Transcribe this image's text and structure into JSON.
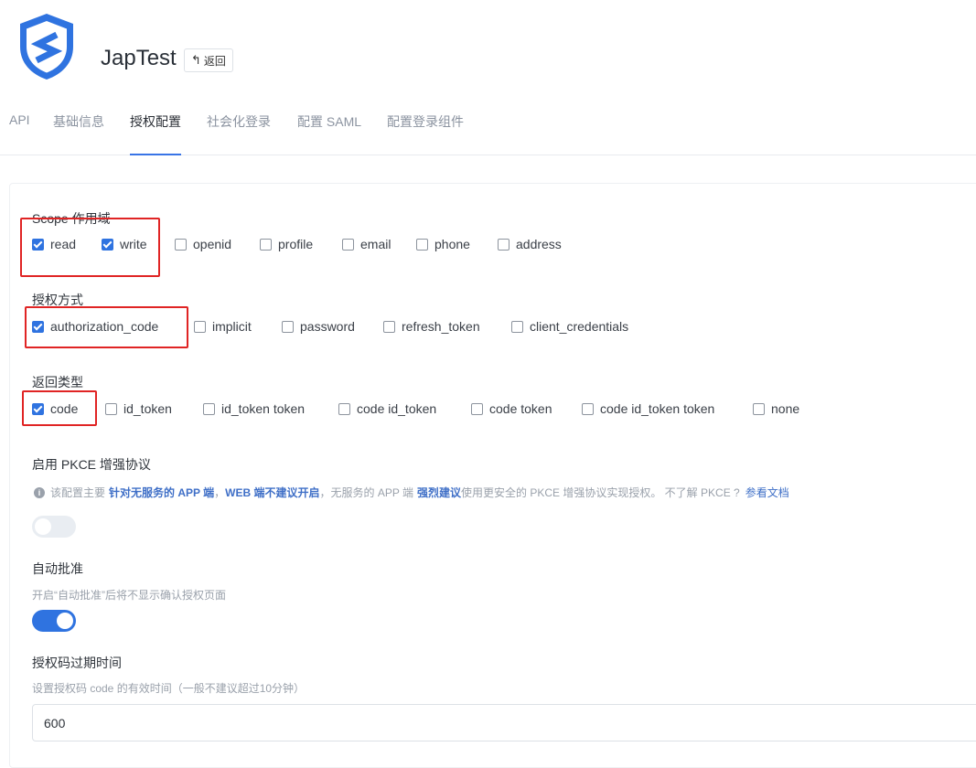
{
  "header": {
    "app_name": "JapTest",
    "back_label": "返回"
  },
  "tabs": [
    {
      "label": "API",
      "active": false
    },
    {
      "label": "基础信息",
      "active": false
    },
    {
      "label": "授权配置",
      "active": true
    },
    {
      "label": "社会化登录",
      "active": false
    },
    {
      "label": "配置 SAML",
      "active": false
    },
    {
      "label": "配置登录组件",
      "active": false
    }
  ],
  "scope": {
    "label": "Scope 作用域",
    "options": [
      {
        "label": "read",
        "checked": true
      },
      {
        "label": "write",
        "checked": true
      },
      {
        "label": "openid",
        "checked": false
      },
      {
        "label": "profile",
        "checked": false
      },
      {
        "label": "email",
        "checked": false
      },
      {
        "label": "phone",
        "checked": false
      },
      {
        "label": "address",
        "checked": false
      }
    ]
  },
  "grant_type": {
    "label": "授权方式",
    "options": [
      {
        "label": "authorization_code",
        "checked": true
      },
      {
        "label": "implicit",
        "checked": false
      },
      {
        "label": "password",
        "checked": false
      },
      {
        "label": "refresh_token",
        "checked": false
      },
      {
        "label": "client_credentials",
        "checked": false
      }
    ]
  },
  "response_type": {
    "label": "返回类型",
    "options": [
      {
        "label": "code",
        "checked": true
      },
      {
        "label": "id_token",
        "checked": false
      },
      {
        "label": "id_token token",
        "checked": false
      },
      {
        "label": "code id_token",
        "checked": false
      },
      {
        "label": "code token",
        "checked": false
      },
      {
        "label": "code id_token token",
        "checked": false
      },
      {
        "label": "none",
        "checked": false
      }
    ]
  },
  "pkce": {
    "label": "启用 PKCE 增强协议",
    "info_part1": "该配置主要",
    "info_bold1": "针对无服务的 APP 端",
    "info_part2": "，",
    "info_bold2": "WEB 端不建议开启",
    "info_part3": "，无服务的 APP 端",
    "info_bold3": "强烈建议",
    "info_part4": "使用更安全的 PKCE 增强协议实现授权。 不了解 PKCE ?",
    "info_link": "参看文档",
    "enabled": false
  },
  "auto_approve": {
    "label": "自动批准",
    "hint": "开启“自动批准”后将不显示确认授权页面",
    "enabled": true
  },
  "code_expiry": {
    "label": "授权码过期时间",
    "hint": "设置授权码 code 的有效时间（一般不建议超过10分钟）",
    "value": "600"
  },
  "colors": {
    "accent": "#2f73e0",
    "highlight_box": "#e02424"
  }
}
